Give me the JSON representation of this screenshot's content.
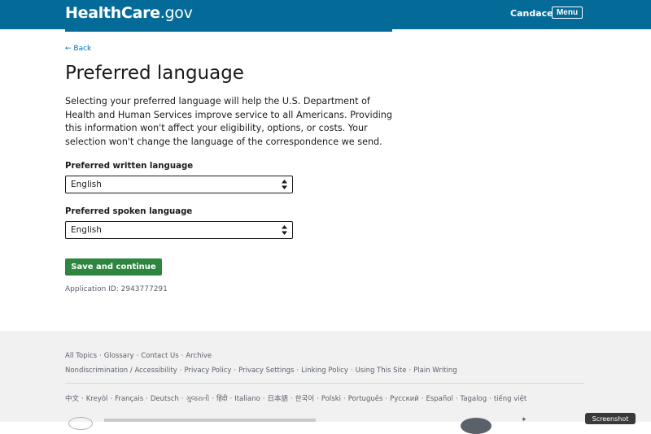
{
  "header": {
    "logo_bold": "HealthCare",
    "logo_light": ".gov",
    "user_name": "Candace",
    "menu_label": "Menu"
  },
  "nav": {
    "back_label": "Back"
  },
  "page": {
    "title": "Preferred language",
    "intro": "Selecting your preferred language will help the U.S. Department of Health and Human Services improve service to all Americans. Providing this information won't affect your eligibility, options, or costs. Your selection won't change the language of the correspondence we send."
  },
  "form": {
    "written": {
      "label": "Preferred written language",
      "value": "English"
    },
    "spoken": {
      "label": "Preferred spoken language",
      "value": "English"
    },
    "save_label": "Save and continue",
    "application_id": "Application ID: 2943777291"
  },
  "footer": {
    "row1": [
      "All Topics",
      "Glossary",
      "Contact Us",
      "Archive"
    ],
    "row2": [
      "Nondiscrimination / Accessibility",
      "Privacy Policy",
      "Privacy Settings",
      "Linking Policy",
      "Using This Site",
      "Plain Writing"
    ],
    "languages": [
      "中文",
      "Kreyòl",
      "Français",
      "Deutsch",
      "ગુજરાતી",
      "हिंदी",
      "Italiano",
      "日本語",
      "한국어",
      "Polski",
      "Português",
      "Русский",
      "Español",
      "Tagalog",
      "tiếng việt"
    ]
  },
  "overlay": {
    "screenshot_label": "Screenshot"
  },
  "colors": {
    "header_bg": "#046b99",
    "link": "#0071bc",
    "primary_button": "#2e8540",
    "footer_bg": "#f1f1f1"
  }
}
